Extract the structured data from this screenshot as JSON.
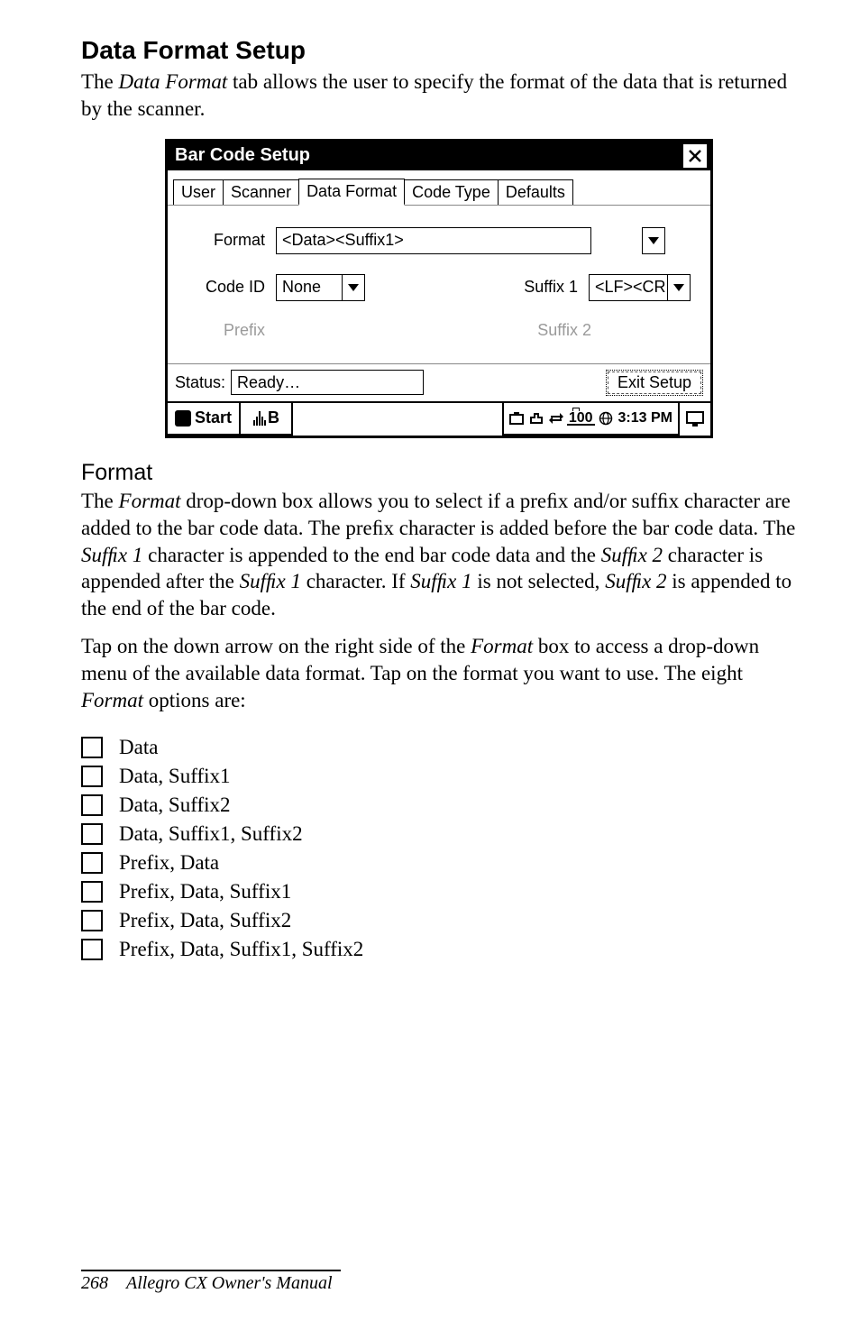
{
  "heading": "Data Format Setup",
  "intro_pre": "The ",
  "intro_em1": "Data Format",
  "intro_post": " tab allows the user to specify the format of the data that is returned by the scanner.",
  "shot": {
    "title": "Bar Code Setup",
    "tabs": [
      "User",
      "Scanner",
      "Data Format",
      "Code Type",
      "Defaults"
    ],
    "labels": {
      "format": "Format",
      "code_id": "Code ID",
      "suffix1": "Suffix 1",
      "prefix": "Prefix",
      "suffix2": "Suffix 2"
    },
    "values": {
      "format": "<Data><Suffix1>",
      "code_id": "None",
      "suffix1": "<LF><CR"
    },
    "status_label": "Status:",
    "status_value": "Ready…",
    "exit_label": "Exit Setup",
    "start_label": "Start",
    "task_label": "B",
    "tray_100": "100",
    "tray_time": "3:13 PM"
  },
  "sub_heading": "Format",
  "para1": "The Format drop-down box allows you to select if a prefix and/or suffix character are added to the bar code data. The prefix character is added before the bar code data. The Suffix 1 character is appended to the end bar code data and the Suffix 2 character is appended after the Suffix 1 character. If Suffix 1 is not selected, Suffix 2 is appended to the end of the bar code.",
  "para2": "Tap on the down arrow on the right side of the Format box to access a drop-down menu of the available data format. Tap on the format you want to use. The eight Format options are:",
  "options": [
    "Data",
    "Data, Suffix1",
    "Data, Suffix2",
    "Data, Suffix1, Suffix2",
    "Prefix, Data",
    "Prefix, Data, Suffix1",
    "Prefix, Data, Suffix2",
    "Prefix, Data, Suffix1, Suffix2"
  ],
  "footer_page": "268",
  "footer_title": "Allegro CX Owner's Manual"
}
